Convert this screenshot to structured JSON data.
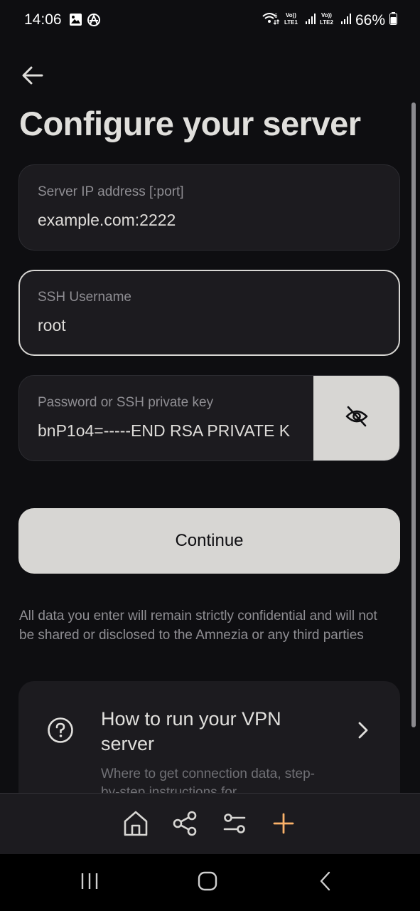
{
  "status_bar": {
    "time": "14:06",
    "battery": "66%",
    "icons": [
      "gallery-icon",
      "vpn-app-icon",
      "wifi-icon",
      "volte-lte1-icon",
      "signal-icon",
      "volte-lte2-icon",
      "signal-icon",
      "battery-icon"
    ],
    "lte1": "LTE1",
    "lte2": "LTE2",
    "volte": "Vo))"
  },
  "header": {
    "back_icon": "arrow-left-icon",
    "title": "Configure your server"
  },
  "form": {
    "server_ip": {
      "label": "Server IP address [:port]",
      "value": "example.com:2222"
    },
    "username": {
      "label": "SSH Username",
      "value": "root"
    },
    "password": {
      "label": "Password or SSH private key",
      "value": "bnP1o4=-----END RSA PRIVATE K",
      "reveal_icon": "eye-off-icon"
    },
    "continue_label": "Continue"
  },
  "disclaimer": "All data you enter will remain strictly confidential and will not be shared or disclosed to the Amnezia or any third parties",
  "help_card": {
    "icon": "question-circle-icon",
    "title": "How to run your VPN server",
    "description": "Where to get connection data, step-by-step instructions for",
    "chevron": "chevron-right-icon"
  },
  "tab_bar": {
    "tabs": [
      "home-icon",
      "share-icon",
      "settings-sliders-icon",
      "plus-icon"
    ],
    "active_color": "#fbb26a"
  },
  "nav_bar": {
    "buttons": [
      "recent-apps-icon",
      "home-pill-icon",
      "back-chevron-icon"
    ]
  }
}
